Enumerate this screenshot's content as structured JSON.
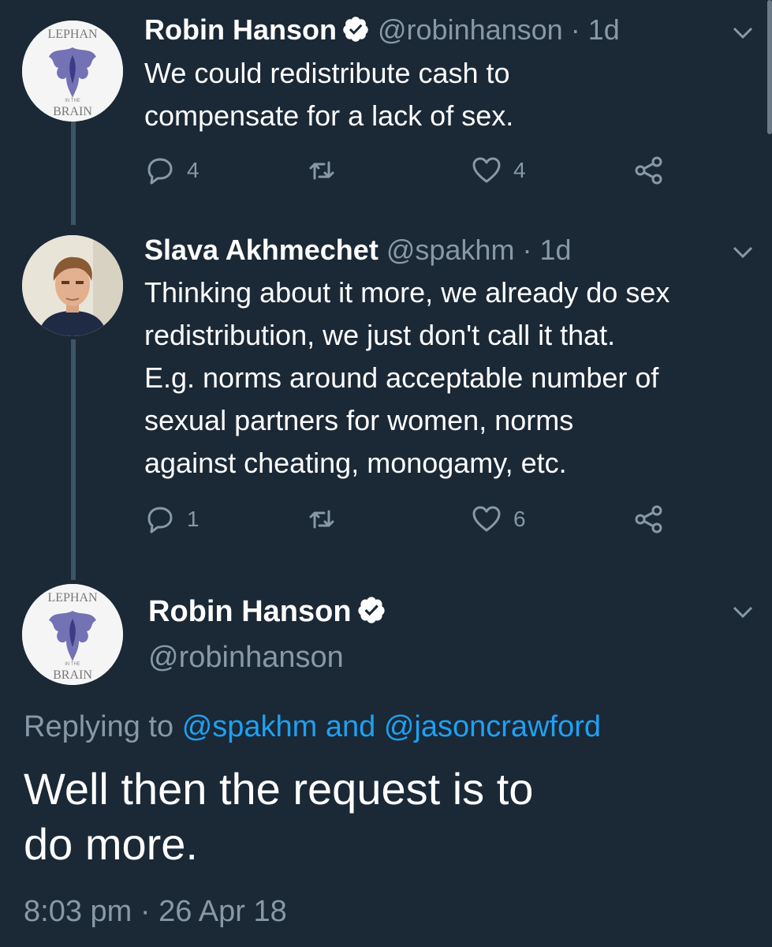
{
  "tweets": [
    {
      "name": "Robin Hanson",
      "handle": "@robinhanson",
      "time": "1d",
      "text_lines": [
        "We could redistribute cash to",
        "compensate for a lack of sex."
      ],
      "replies": "4",
      "likes": "4",
      "avatar": {
        "top_text": "LEPHAN",
        "middle_text": "IN THE",
        "bottom_text": "BRAIN"
      }
    },
    {
      "name": "Slava Akhmechet",
      "handle": "@spakhm",
      "time": "1d",
      "text_lines": [
        "Thinking about it more, we already do sex",
        "redistribution, we just don't call it that.",
        "E.g. norms around acceptable number of",
        "sexual partners for women, norms",
        "against cheating, monogamy, etc."
      ],
      "replies": "1",
      "likes": "6"
    }
  ],
  "focused": {
    "name": "Robin Hanson",
    "handle": "@robinhanson",
    "replying_prefix": "Replying to",
    "mention1": "@spakhm",
    "conjunction": "and",
    "mention2": "@jasoncrawford",
    "text_lines": [
      "Well then the request is to",
      "do more."
    ],
    "timestamp": "8:03 pm · 26 Apr 18",
    "avatar": {
      "top_text": "LEPHAN",
      "middle_text": "IN THE",
      "bottom_text": "BRAIN"
    }
  },
  "separator": "·",
  "colors": {
    "background": "#1b2836",
    "secondary_text": "#8899a6",
    "link": "#1da1f2",
    "thread_line": "#3d5466"
  },
  "icons": [
    "verified-badge-icon",
    "chevron-down-icon",
    "reply-icon",
    "retweet-icon",
    "like-icon",
    "share-icon"
  ]
}
